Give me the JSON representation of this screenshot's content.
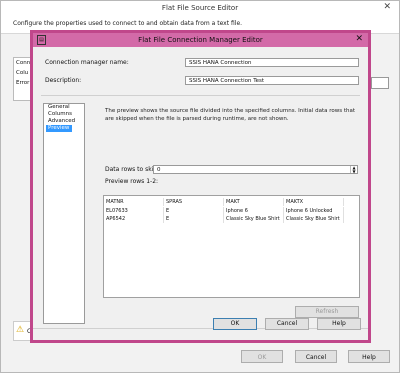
{
  "outer": {
    "title": "Flat File Source Editor",
    "close_glyph": "✕",
    "description": "Configure the properties used to connect to and obtain data from a text file.",
    "side_items": [
      "Conn",
      "Colu",
      "Error"
    ],
    "warning_text": "C",
    "ok_label": "OK",
    "cancel_label": "Cancel",
    "help_label": "Help"
  },
  "inner": {
    "title": "Flat File Connection Manager Editor",
    "close_glyph": "✕",
    "conn_name_label": "Connection manager name:",
    "conn_name_value": "SSIS HANA Connection",
    "description_label": "Description:",
    "description_value": "SSIS HANA Connection Test",
    "nav": [
      "General",
      "Columns",
      "Advanced",
      "Preview"
    ],
    "nav_selected": "Preview",
    "info_text": "The preview shows the source file divided into the specified columns. Initial data rows that are skipped when the file is parsed during runtime, are not shown.",
    "skip_label": "Data rows to skip:",
    "skip_value": "0",
    "preview_label": "Preview rows 1-2:",
    "grid": {
      "columns": [
        "MATNR",
        "SPRAS",
        "MAKT",
        "MAKTX"
      ],
      "rows": [
        [
          "EL07633",
          "E",
          "Iphone 6",
          "Iphone 6 Unlocked"
        ],
        [
          "AP6542",
          "E",
          "Classic Sky Blue Shirt",
          "Classic Sky Blue Shirt"
        ]
      ]
    },
    "refresh_label": "Refresh",
    "ok_label": "OK",
    "cancel_label": "Cancel",
    "help_label": "Help"
  }
}
